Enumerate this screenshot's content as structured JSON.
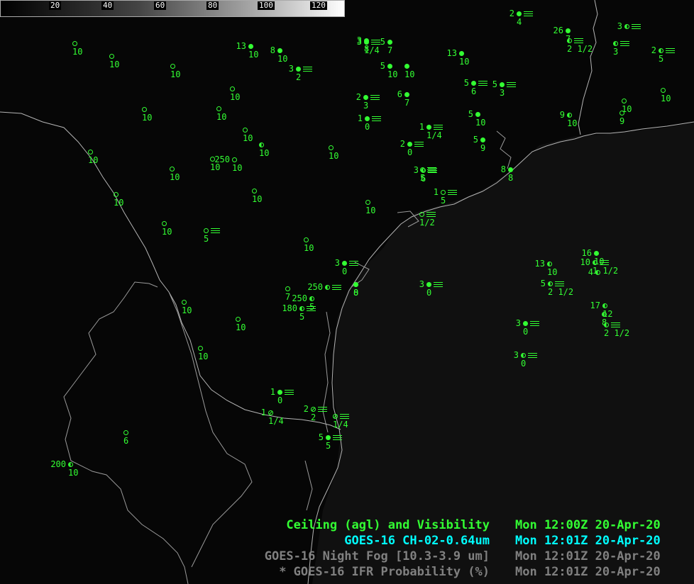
{
  "colorbar": {
    "ticks": [
      "20",
      "40",
      "60",
      "80",
      "100",
      "120"
    ]
  },
  "stations": [
    {
      "ceiling": "2",
      "visibility": "4",
      "symbol": "full",
      "fog": true
    },
    {
      "ceiling": "3",
      "visibility": "8",
      "symbol": "full",
      "fog": false
    },
    {
      "ceiling": "",
      "visibility": "10",
      "symbol": "empty",
      "fog": false
    },
    {
      "ceiling": "",
      "visibility": "10",
      "symbol": "empty",
      "fog": false
    },
    {
      "ceiling": "13",
      "visibility": "10",
      "symbol": "full",
      "fog": false
    },
    {
      "ceiling": "8",
      "visibility": "10",
      "symbol": "full",
      "fog": false
    },
    {
      "ceiling": "3",
      "visibility": "1/4",
      "symbol": "full",
      "fog": true
    },
    {
      "ceiling": "5",
      "visibility": "7",
      "symbol": "full",
      "fog": false
    },
    {
      "ceiling": "13",
      "visibility": "10",
      "symbol": "full",
      "fog": false
    },
    {
      "ceiling": "26",
      "visibility": "7",
      "symbol": "full",
      "fog": false
    },
    {
      "ceiling": "",
      "visibility": "2 1/2",
      "symbol": "half",
      "fog": true
    },
    {
      "ceiling": "",
      "visibility": "3",
      "symbol": "half",
      "fog": true
    },
    {
      "ceiling": "3",
      "visibility": "",
      "symbol": "half",
      "fog": true
    },
    {
      "ceiling": "2",
      "visibility": "5",
      "symbol": "half",
      "fog": true
    },
    {
      "ceiling": "",
      "visibility": "10",
      "symbol": "empty",
      "fog": false
    },
    {
      "ceiling": "3",
      "visibility": "2",
      "symbol": "full",
      "fog": true
    },
    {
      "ceiling": "5",
      "visibility": "10",
      "symbol": "full",
      "fog": false
    },
    {
      "ceiling": "",
      "visibility": "10",
      "symbol": "full",
      "fog": false
    },
    {
      "ceiling": "5",
      "visibility": "6",
      "symbol": "full",
      "fog": true
    },
    {
      "ceiling": "5",
      "visibility": "3",
      "symbol": "full",
      "fog": true
    },
    {
      "ceiling": "",
      "visibility": "10",
      "symbol": "empty",
      "fog": false
    },
    {
      "ceiling": "",
      "visibility": "10",
      "symbol": "empty",
      "fog": false
    },
    {
      "ceiling": "2",
      "visibility": "3",
      "symbol": "full",
      "fog": true
    },
    {
      "ceiling": "6",
      "visibility": "7",
      "symbol": "full",
      "fog": false
    },
    {
      "ceiling": "",
      "visibility": "10",
      "symbol": "empty",
      "fog": false
    },
    {
      "ceiling": "",
      "visibility": "10",
      "symbol": "empty",
      "fog": false
    },
    {
      "ceiling": "",
      "visibility": "10",
      "symbol": "empty",
      "fog": false
    },
    {
      "ceiling": "1",
      "visibility": "0",
      "symbol": "full",
      "fog": true
    },
    {
      "ceiling": "5",
      "visibility": "10",
      "symbol": "full",
      "fog": false
    },
    {
      "ceiling": "9",
      "visibility": "10",
      "symbol": "half",
      "fog": false
    },
    {
      "ceiling": "",
      "visibility": "9",
      "symbol": "empty",
      "fog": false
    },
    {
      "ceiling": "",
      "visibility": "10",
      "symbol": "empty",
      "fog": false
    },
    {
      "ceiling": "1",
      "visibility": "1/4",
      "symbol": "full",
      "fog": true
    },
    {
      "ceiling": "",
      "visibility": "10",
      "symbol": "empty",
      "fog": false
    },
    {
      "ceiling": "250",
      "visibility": "10",
      "symbol": "empty",
      "fog": false
    },
    {
      "ceiling": "",
      "visibility": "10",
      "symbol": "half",
      "fog": false
    },
    {
      "ceiling": "2",
      "visibility": "0",
      "symbol": "full",
      "fog": true
    },
    {
      "ceiling": "3",
      "visibility": "6",
      "symbol": "half",
      "fog": true
    },
    {
      "ceiling": "5",
      "visibility": "9",
      "symbol": "full",
      "fog": false
    },
    {
      "ceiling": "",
      "visibility": "10",
      "symbol": "empty",
      "fog": false
    },
    {
      "ceiling": "",
      "visibility": "10",
      "symbol": "empty",
      "fog": false
    },
    {
      "ceiling": "",
      "visibility": "10",
      "symbol": "empty",
      "fog": false
    },
    {
      "ceiling": "",
      "visibility": "10",
      "symbol": "empty",
      "fog": false
    },
    {
      "ceiling": "8",
      "visibility": "8",
      "symbol": "full",
      "fog": false
    },
    {
      "ceiling": "",
      "visibility": "5",
      "symbol": "empty",
      "fog": true
    },
    {
      "ceiling": "1",
      "visibility": "5",
      "symbol": "empty",
      "fog": true
    },
    {
      "ceiling": "",
      "visibility": "10",
      "symbol": "empty",
      "fog": false
    },
    {
      "ceiling": "",
      "visibility": "10",
      "symbol": "empty",
      "fog": false
    },
    {
      "ceiling": "",
      "visibility": "5",
      "symbol": "empty",
      "fog": true
    },
    {
      "ceiling": "",
      "visibility": "10",
      "symbol": "empty",
      "fog": false
    },
    {
      "ceiling": "",
      "visibility": "10",
      "symbol": "empty",
      "fog": false
    },
    {
      "ceiling": "",
      "visibility": "1/2",
      "symbol": "empty",
      "fog": true
    },
    {
      "ceiling": "",
      "visibility": "10",
      "symbol": "empty",
      "fog": false
    },
    {
      "ceiling": "",
      "visibility": "8",
      "symbol": "full",
      "fog": false
    },
    {
      "ceiling": "3",
      "visibility": "0",
      "symbol": "full",
      "fog": true
    },
    {
      "ceiling": "250",
      "visibility": "",
      "symbol": "half",
      "fog": true
    },
    {
      "ceiling": "",
      "visibility": "0",
      "symbol": "full",
      "fog": false
    },
    {
      "ceiling": "3",
      "visibility": "0",
      "symbol": "full",
      "fog": true
    },
    {
      "ceiling": "250",
      "visibility": "5",
      "symbol": "half",
      "fog": false
    },
    {
      "ceiling": "180",
      "visibility": "5",
      "symbol": "half",
      "fog": true
    },
    {
      "ceiling": "",
      "visibility": "10",
      "symbol": "empty",
      "fog": false
    },
    {
      "ceiling": "",
      "visibility": "7",
      "symbol": "empty",
      "fog": false
    },
    {
      "ceiling": "",
      "visibility": "10",
      "symbol": "empty",
      "fog": false
    },
    {
      "ceiling": "16",
      "visibility": "10",
      "symbol": "full",
      "fog": false
    },
    {
      "ceiling": "10",
      "visibility": "1 1/2",
      "symbol": "half",
      "fog": true
    },
    {
      "ceiling": "4",
      "visibility": "",
      "symbol": "half",
      "fog": false
    },
    {
      "ceiling": "13",
      "visibility": "10",
      "symbol": "half",
      "fog": false
    },
    {
      "ceiling": "5",
      "visibility": "2 1/2",
      "symbol": "half",
      "fog": true
    },
    {
      "ceiling": "17",
      "visibility": "12",
      "symbol": "half",
      "fog": false
    },
    {
      "ceiling": "",
      "visibility": "8",
      "symbol": "half",
      "fog": false
    },
    {
      "ceiling": "",
      "visibility": "2 1/2",
      "symbol": "half",
      "fog": true
    },
    {
      "ceiling": "3",
      "visibility": "0",
      "symbol": "full",
      "fog": true
    },
    {
      "ceiling": "3",
      "visibility": "0",
      "symbol": "half",
      "fog": true
    },
    {
      "ceiling": "1",
      "visibility": "0",
      "symbol": "full",
      "fog": true
    },
    {
      "ceiling": "1",
      "visibility": "1/4",
      "symbol": "x",
      "fog": false
    },
    {
      "ceiling": "2",
      "visibility": "2",
      "symbol": "x",
      "fog": true
    },
    {
      "ceiling": "",
      "visibility": "1/4",
      "symbol": "x",
      "fog": true
    },
    {
      "ceiling": "5",
      "visibility": "5",
      "symbol": "full",
      "fog": true
    },
    {
      "ceiling": "",
      "visibility": "6",
      "symbol": "empty",
      "fog": false
    },
    {
      "ceiling": "200",
      "visibility": "10",
      "symbol": "half",
      "fog": false
    }
  ],
  "legend": [
    {
      "title": "Ceiling (agl) and Visibility",
      "time": "Mon 12:00Z 20-Apr-20",
      "color": "#33ff33"
    },
    {
      "title": "GOES-16 CH-02-0.64um",
      "time": "Mon 12:01Z 20-Apr-20",
      "color": "#00ffff"
    },
    {
      "title": "GOES-16 Night Fog [10.3-3.9 um]",
      "time": "Mon 12:01Z 20-Apr-20",
      "color": "#808080"
    },
    {
      "title": "* GOES-16 IFR Probability (%)",
      "time": "Mon 12:01Z 20-Apr-20",
      "color": "#808080"
    }
  ]
}
